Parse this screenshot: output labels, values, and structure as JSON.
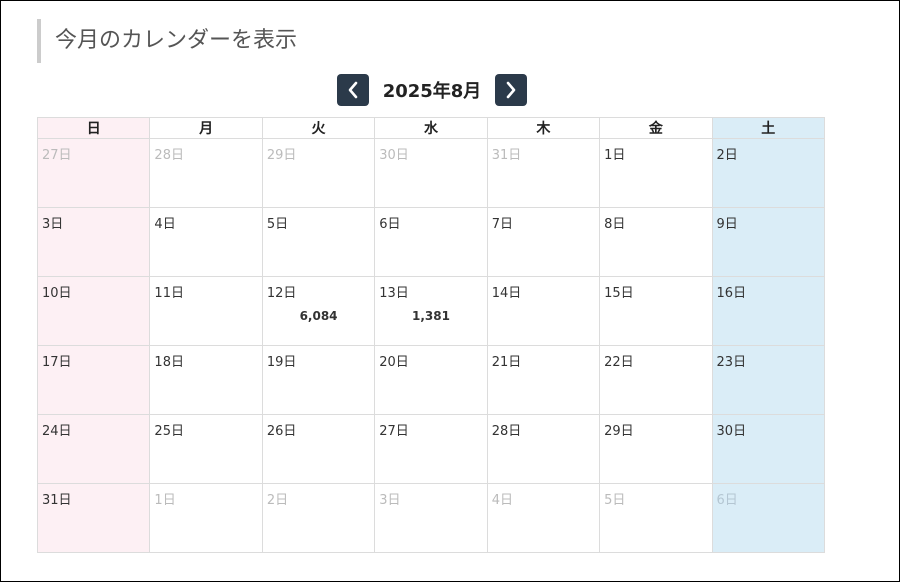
{
  "header": {
    "title": "今月のカレンダーを表示"
  },
  "calendar": {
    "month_label": "2025年8月",
    "weekdays": [
      "日",
      "月",
      "火",
      "水",
      "木",
      "金",
      "土"
    ],
    "weeks": [
      [
        {
          "label": "27日",
          "other": true
        },
        {
          "label": "28日",
          "other": true
        },
        {
          "label": "29日",
          "other": true
        },
        {
          "label": "30日",
          "other": true
        },
        {
          "label": "31日",
          "other": true
        },
        {
          "label": "1日",
          "other": false
        },
        {
          "label": "2日",
          "other": false
        }
      ],
      [
        {
          "label": "3日",
          "other": false
        },
        {
          "label": "4日",
          "other": false
        },
        {
          "label": "5日",
          "other": false
        },
        {
          "label": "6日",
          "other": false
        },
        {
          "label": "7日",
          "other": false
        },
        {
          "label": "8日",
          "other": false
        },
        {
          "label": "9日",
          "other": false
        }
      ],
      [
        {
          "label": "10日",
          "other": false
        },
        {
          "label": "11日",
          "other": false
        },
        {
          "label": "12日",
          "other": false,
          "count": "6,084"
        },
        {
          "label": "13日",
          "other": false,
          "count": "1,381"
        },
        {
          "label": "14日",
          "other": false
        },
        {
          "label": "15日",
          "other": false
        },
        {
          "label": "16日",
          "other": false
        }
      ],
      [
        {
          "label": "17日",
          "other": false
        },
        {
          "label": "18日",
          "other": false
        },
        {
          "label": "19日",
          "other": false
        },
        {
          "label": "20日",
          "other": false
        },
        {
          "label": "21日",
          "other": false
        },
        {
          "label": "22日",
          "other": false
        },
        {
          "label": "23日",
          "other": false
        }
      ],
      [
        {
          "label": "24日",
          "other": false
        },
        {
          "label": "25日",
          "other": false
        },
        {
          "label": "26日",
          "other": false
        },
        {
          "label": "27日",
          "other": false
        },
        {
          "label": "28日",
          "other": false
        },
        {
          "label": "29日",
          "other": false
        },
        {
          "label": "30日",
          "other": false
        }
      ],
      [
        {
          "label": "31日",
          "other": false
        },
        {
          "label": "1日",
          "other": true
        },
        {
          "label": "2日",
          "other": true
        },
        {
          "label": "3日",
          "other": true
        },
        {
          "label": "4日",
          "other": true
        },
        {
          "label": "5日",
          "other": true
        },
        {
          "label": "6日",
          "other": true
        }
      ]
    ]
  },
  "icons": {
    "prev": "chevron-left-icon",
    "next": "chevron-right-icon"
  },
  "colors": {
    "nav_button": "#2b3a4a",
    "sunday_bg": "#fdf0f4",
    "saturday_bg": "#daedf7",
    "other_month_text": "#bbbbbb",
    "grid_border": "#dcdcdc"
  }
}
